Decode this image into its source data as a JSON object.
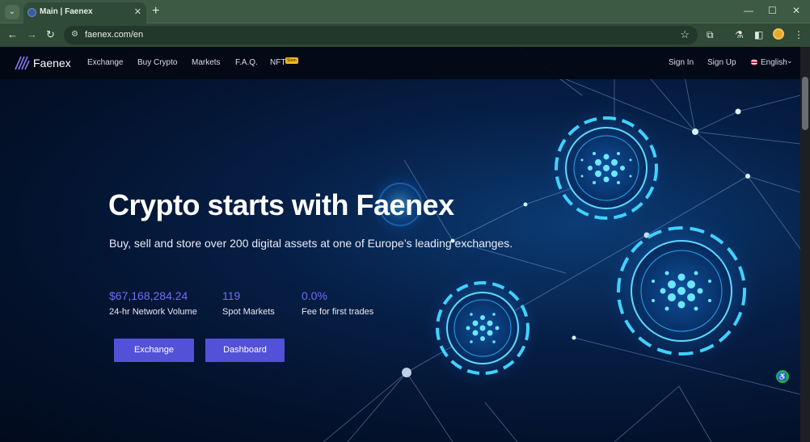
{
  "browser": {
    "tab_title": "Main | Faenex",
    "url": "faenex.com/en",
    "tab_close": "✕",
    "new_tab": "+",
    "window_controls": [
      "—",
      "☐",
      "✕"
    ],
    "icons": [
      "tab-search-icon",
      "back-icon",
      "forward-icon",
      "reload-icon",
      "site-info-icon",
      "star-icon",
      "extensions-icon",
      "labs-icon",
      "side-panel-icon",
      "profile-avatar",
      "menu-icon"
    ]
  },
  "site": {
    "brand": "Faenex",
    "nav": {
      "exchange": "Exchange",
      "buy_crypto": "Buy Crypto",
      "markets": "Markets",
      "faq": "F.A.Q.",
      "nft": "NFT",
      "nft_badge": "Soon",
      "sign_in": "Sign In",
      "sign_up": "Sign Up",
      "language": "English"
    },
    "hero": {
      "title": "Crypto starts with Faenex",
      "subtitle": "Buy, sell and store over 200 digital assets at one of Europe’s leading exchanges."
    },
    "stats": [
      {
        "value": "$67,168,284.24",
        "label": "24-hr Network Volume"
      },
      {
        "value": "119",
        "label": "Spot Markets"
      },
      {
        "value": "0.0%",
        "label": "Fee for first trades"
      }
    ],
    "buttons": {
      "exchange": "Exchange",
      "dashboard": "Dashboard"
    }
  },
  "colors": {
    "accent": "#5351d8",
    "stat_value": "#6f6df2",
    "badge": "#f4b820",
    "browser_frame": "#3d5a44",
    "page_bg": "#03112a",
    "glow": "#35c8ff"
  }
}
